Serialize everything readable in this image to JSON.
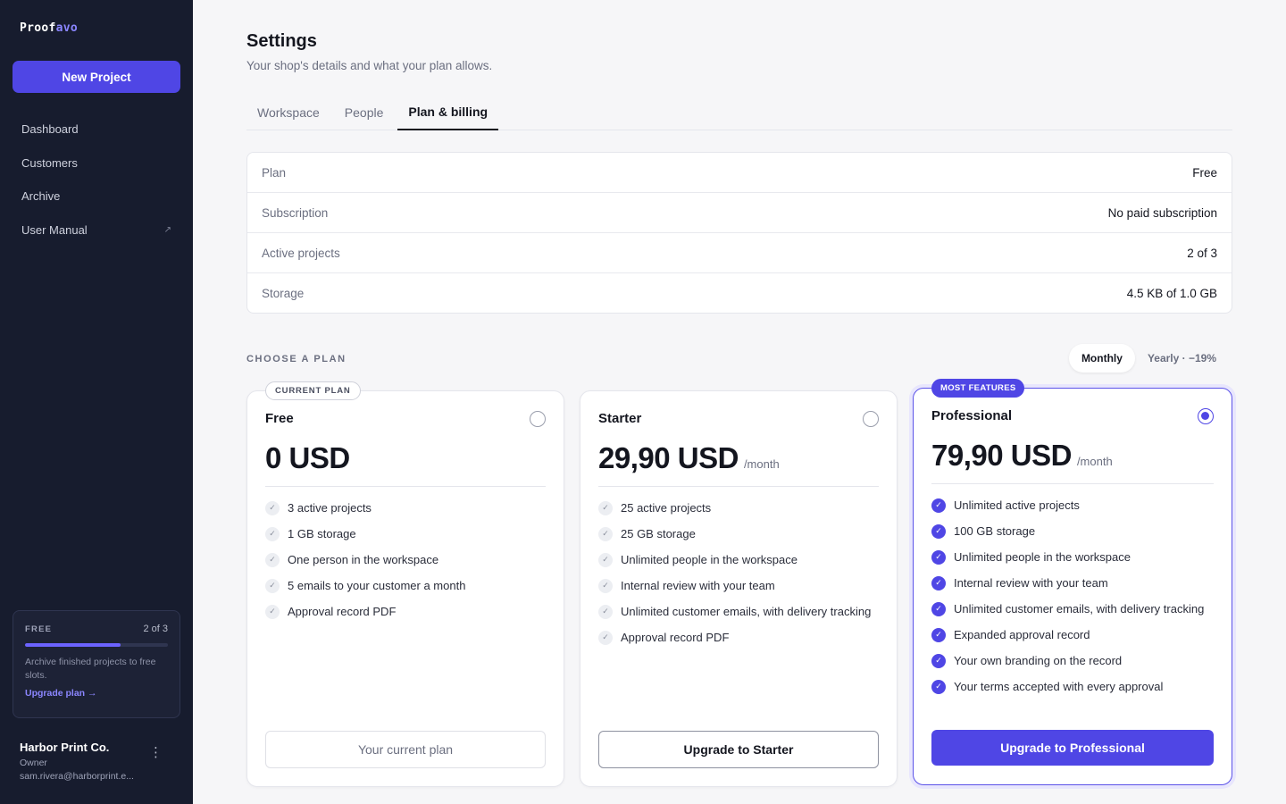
{
  "app": {
    "brand_part1": "Proof",
    "brand_part2": "avo",
    "new_project_label": "New Project"
  },
  "sidebar": {
    "items": [
      {
        "label": "Dashboard"
      },
      {
        "label": "Customers"
      },
      {
        "label": "Archive"
      },
      {
        "label": "User Manual",
        "external_icon": "external-link-icon",
        "external_glyph": "↗"
      }
    ],
    "usage": {
      "plan": "FREE",
      "count": "2 of 3",
      "fraction": 0.67,
      "text": "Archive finished projects to free slots.",
      "link": "Upgrade plan →"
    },
    "account": {
      "name": "Harbor Print Co.",
      "role": "Owner",
      "email": "sam.rivera@harborprint.e...",
      "menu_glyph": "⋮"
    }
  },
  "header": {
    "title": "Settings",
    "subtitle": "Your shop's details and what your plan allows."
  },
  "tabs": [
    {
      "label": "Workspace",
      "active": false
    },
    {
      "label": "People",
      "active": false
    },
    {
      "label": "Plan & billing",
      "active": true
    }
  ],
  "plan_summary": [
    {
      "label": "Plan",
      "value": "Free"
    },
    {
      "label": "Subscription",
      "value": "No paid subscription"
    },
    {
      "label": "Active projects",
      "value": "2 of 3"
    },
    {
      "label": "Storage",
      "value": "4.5 KB of 1.0 GB"
    }
  ],
  "choose_plan": {
    "heading": "CHOOSE A PLAN",
    "toggle": {
      "monthly": "Monthly",
      "yearly": "Yearly · −19%",
      "selected": "monthly"
    }
  },
  "plans": [
    {
      "id": "free",
      "badge": "CURRENT PLAN",
      "name": "Free",
      "price": "0 USD",
      "period": "",
      "selected": false,
      "features": [
        "3 active projects",
        "1 GB storage",
        "One person in the workspace",
        "5 emails to your customer a month",
        "Approval record PDF"
      ],
      "button": "Your current plan"
    },
    {
      "id": "starter",
      "badge": "",
      "name": "Starter",
      "price": "29,90 USD",
      "period": "/month",
      "selected": false,
      "features": [
        "25 active projects",
        "25 GB storage",
        "Unlimited people in the workspace",
        "Internal review with your team",
        "Unlimited customer emails, with delivery tracking",
        "Approval record PDF"
      ],
      "button": "Upgrade to Starter"
    },
    {
      "id": "pro",
      "badge": "MOST FEATURES",
      "name": "Professional",
      "price": "79,90 USD",
      "period": "/month",
      "selected": true,
      "features": [
        "Unlimited active projects",
        "100 GB storage",
        "Unlimited people in the workspace",
        "Internal review with your team",
        "Unlimited customer emails, with delivery tracking",
        "Expanded approval record",
        "Your own branding on the record",
        "Your terms accepted with every approval"
      ],
      "button": "Upgrade to Professional"
    }
  ],
  "icons": {
    "check": "✓"
  },
  "colors": {
    "accent": "#4f46e5",
    "sidebar_bg": "#171c2e",
    "brand_accent": "#8b86ff"
  }
}
